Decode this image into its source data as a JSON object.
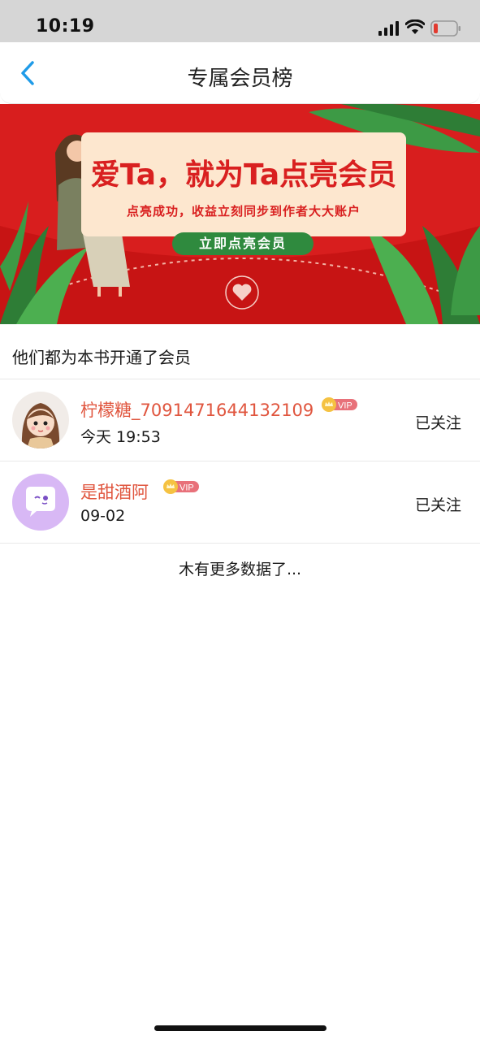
{
  "status_bar": {
    "time": "10:19"
  },
  "nav": {
    "title": "专属会员榜",
    "back_icon": "chevron-left-icon"
  },
  "banner": {
    "headline": "爱Ta，就为Ta点亮会员",
    "subline": "点亮成功，收益立刻同步到作者大大账户",
    "cta_label": "立即点亮会员"
  },
  "section": {
    "title": "他们都为本书开通了会员"
  },
  "members": [
    {
      "name": "柠檬糖_7091471644132109",
      "time": "今天 19:53",
      "badge": "VIP",
      "status": "已关注",
      "avatar": "girl-avatar"
    },
    {
      "name": "是甜酒阿",
      "time": "09-02",
      "badge": "VIP",
      "status": "已关注",
      "avatar": "chat-bubble-avatar"
    }
  ],
  "footer": {
    "no_more": "木有更多数据了..."
  },
  "colors": {
    "accent_red": "#d81e1e",
    "name_red": "#e0553e",
    "cta_green": "#2f8a3e",
    "nav_blue": "#1f9be8"
  }
}
